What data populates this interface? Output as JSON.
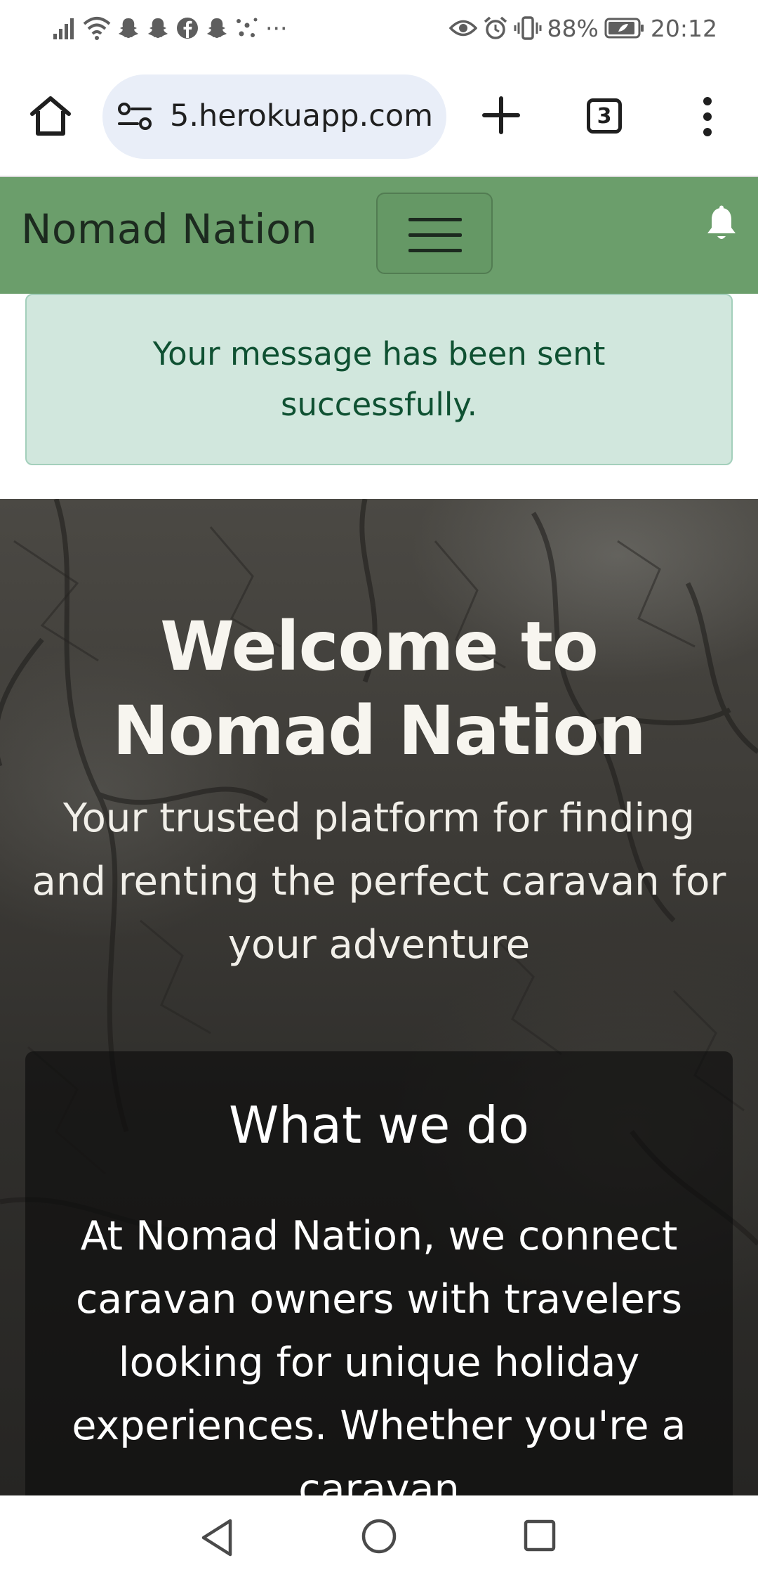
{
  "status_bar": {
    "battery": "88%",
    "time": "20:12",
    "overflow": "···",
    "icons_left": [
      "signal-icon",
      "wifi-icon",
      "snapchat-icon",
      "snapchat-icon",
      "facebook-icon",
      "snapchat-icon",
      "app-dots-icon"
    ],
    "icons_right": [
      "eye-icon",
      "alarm-icon",
      "vibrate-icon",
      "battery-icon"
    ]
  },
  "browser": {
    "url": "5.herokuapp.com",
    "tab_count": "3",
    "icons": [
      "home-icon",
      "site-settings-icon",
      "plus-icon",
      "tabs-icon",
      "more-vert-icon"
    ]
  },
  "site_nav": {
    "brand": "Nomad Nation",
    "icons": [
      "hamburger-icon",
      "bell-icon"
    ],
    "accent_color": "#6b9e6b"
  },
  "alert": {
    "message": "Your message has been sent successfully.",
    "background": "#d1e7dd",
    "text_color": "#0f5132"
  },
  "hero": {
    "title": "Welcome to Nomad Nation",
    "subtitle": "Your trusted platform for finding and renting the perfect caravan for your adventure",
    "card": {
      "title": "What we do",
      "body": "At Nomad Nation, we connect caravan owners with travelers looking for unique holiday experiences. Whether you're a caravan"
    }
  },
  "system_nav": {
    "icons": [
      "back-icon",
      "home-circle-icon",
      "recents-icon"
    ]
  }
}
